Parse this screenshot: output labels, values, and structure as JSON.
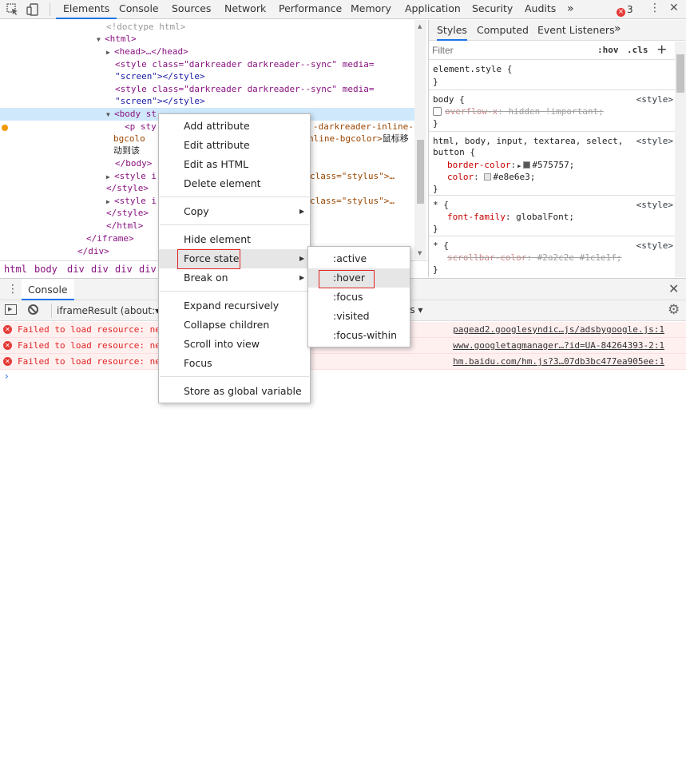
{
  "toolbar": {
    "tabs": [
      "Elements",
      "Console",
      "Sources",
      "Network",
      "Performance",
      "Memory",
      "Application",
      "Security",
      "Audits"
    ],
    "more": "»",
    "error_count": "3",
    "error_badge": "×"
  },
  "elements": {
    "lines": {
      "doctype": "<!doctype html>",
      "html_open": "<html>",
      "head": "<head>…</head>",
      "style1_a": "<style class=\"darkreader darkreader--sync\" media=",
      "style1_b": "\"screen\"></style>",
      "style2_a": "<style class=\"darkreader darkreader--sync\" media=",
      "style2_b": "\"screen\"></style>",
      "body_open": "<body st",
      "body_tail": "f0",
      "p_open": "<p sty",
      "p_right1": "-darkreader-inline-",
      "bgcolo": "bgcolo",
      "p_right2": "nline-bgcolor>",
      "p_cn_right": "鼠标移",
      "p_cn_left": "动到该",
      "body_close": "</body>",
      "style_i1": "<style i",
      "style_i1_right": "class=\"stylus\">…",
      "style_close1": "</style>",
      "style_i2": "<style i",
      "style_i2_right": "class=\"stylus\">…",
      "style_close2": "</style>",
      "html_close": "</html>",
      "iframe_close": "</iframe>",
      "div_close": "</div>"
    }
  },
  "breadcrumb": [
    "html",
    "body",
    "div",
    "div",
    "div",
    "div"
  ],
  "styles": {
    "subtabs": [
      "Styles",
      "Computed",
      "Event Listeners"
    ],
    "more": "»",
    "filter_placeholder": "Filter",
    "hov": ":hov",
    "cls": ".cls",
    "plus": "+",
    "rules": {
      "r0_sel": "element.style {",
      "r0_close": "}",
      "r1_sel": "body {",
      "r1_src": "<style>",
      "r1_prop": "overflow-x",
      "r1_val": ": hidden !important;",
      "r1_close": "}",
      "r2_sel_a": "html, body, input, textarea, select,",
      "r2_sel_b": "button {",
      "r2_src": "<style>",
      "r2_p1": "border-color",
      "r2_v1": "#575757;",
      "r2_p2": "color",
      "r2_v2": "#e8e6e3;",
      "r2_close": "}",
      "r3_sel": "* {",
      "r3_src": "<style>",
      "r3_prop": "font-family",
      "r3_val": ": globalFont;",
      "r3_close": "}",
      "r4_sel": "* {",
      "r4_src": "<style>",
      "r4_prop": "scrollbar-color",
      "r4_val": ": #2a2c2e #1c1e1f;",
      "r4_close": "}"
    },
    "colors": {
      "border": "#575757",
      "text": "#e8e6e3"
    }
  },
  "drawer": {
    "tab": "Console",
    "context": "iframeResult (about:▾",
    "levels": "ls ▾",
    "messages": [
      {
        "text": "Failed to load resource: ne",
        "link": "pagead2.googlesyndic…js/adsbygoogle.js:1"
      },
      {
        "text": "Failed to load resource: ne",
        "link": "www.googletagmanager…?id=UA-84264393-2:1"
      },
      {
        "text": "Failed to load resource: ne",
        "link": "hm.baidu.com/hm.js?3…07db3bc477ea905ee:1"
      }
    ],
    "prompt": "›"
  },
  "context_menu": {
    "items": {
      "add_attribute": "Add attribute",
      "edit_attribute": "Edit attribute",
      "edit_html": "Edit as HTML",
      "delete_element": "Delete element",
      "copy": "Copy",
      "hide_element": "Hide element",
      "force_state": "Force state",
      "break_on": "Break on",
      "expand_recursively": "Expand recursively",
      "collapse_children": "Collapse children",
      "scroll_into_view": "Scroll into view",
      "focus": "Focus",
      "store_global": "Store as global variable"
    },
    "submenu": [
      ":active",
      ":hover",
      ":focus",
      ":visited",
      ":focus-within"
    ],
    "highlight_color": "#e02424"
  }
}
